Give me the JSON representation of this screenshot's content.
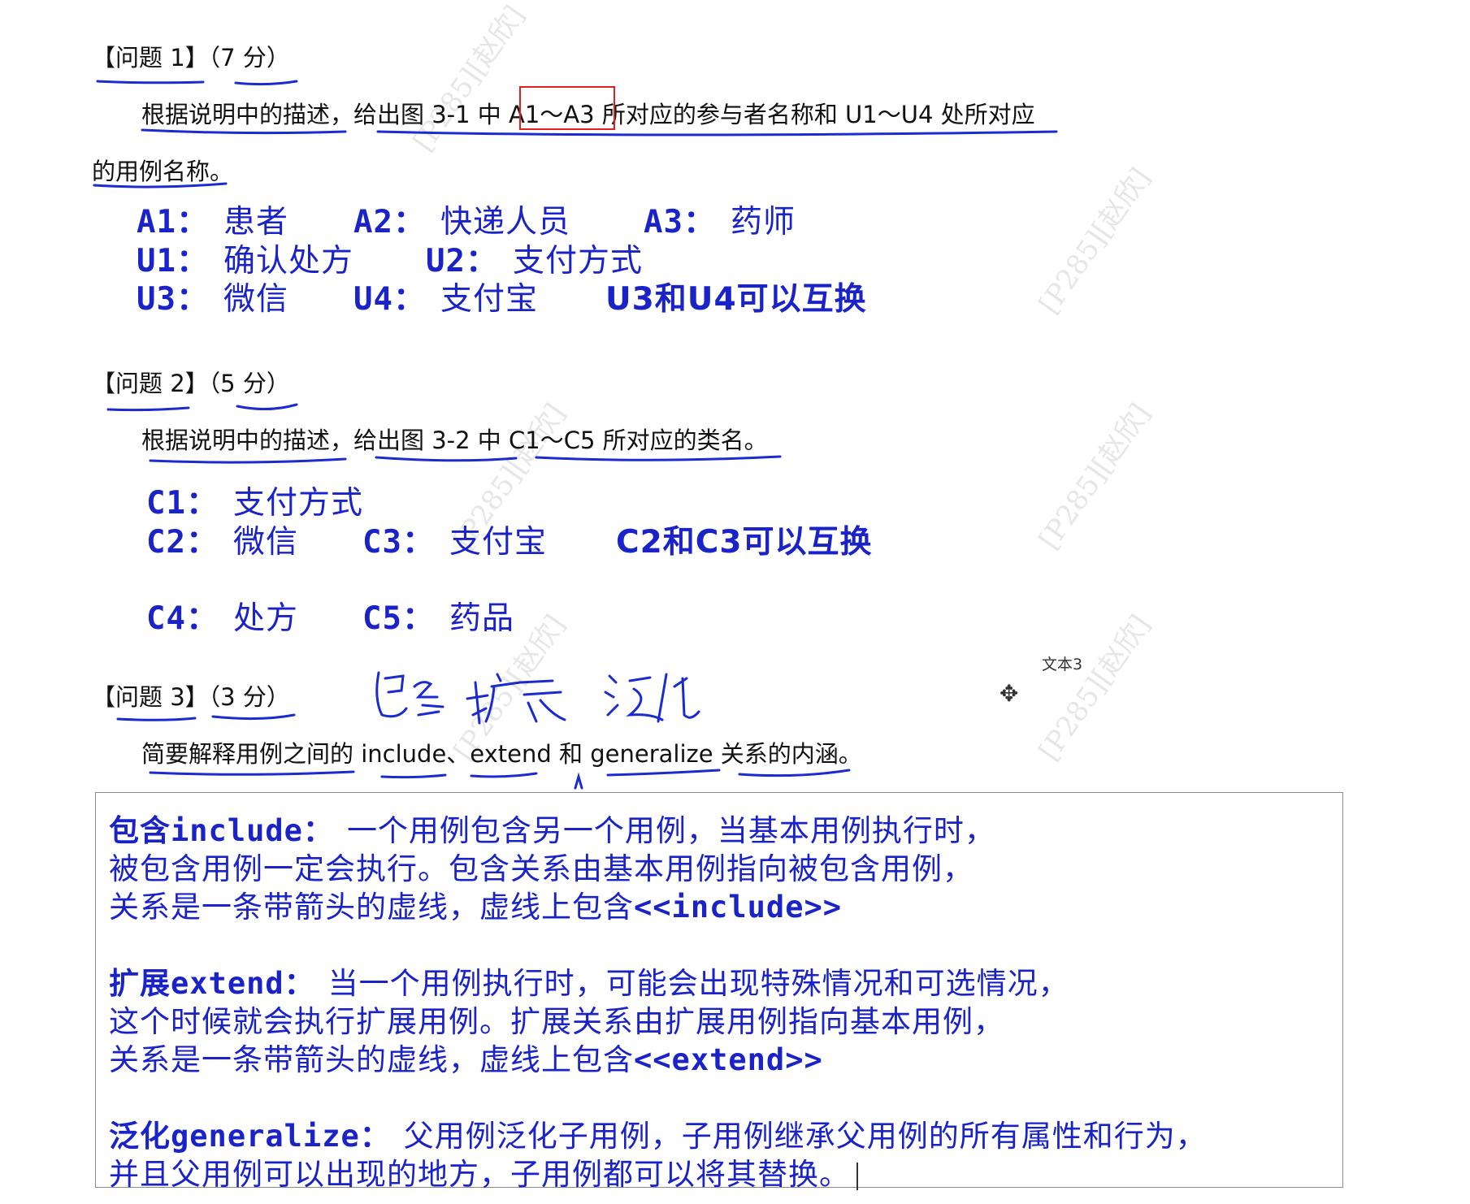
{
  "q1": {
    "heading": "【问题 1】（7 分）",
    "text_line1": "根据说明中的描述，给出图 3-1 中 A1～A3 所对应的参与者名称和 U1～U4 处所对应",
    "text_line2": "的用例名称。",
    "answers": {
      "a1_label": "A1：",
      "a1_value": "患者",
      "a2_label": "A2：",
      "a2_value": "快递人员",
      "a3_label": "A3：",
      "a3_value": "药师",
      "u1_label": "U1：",
      "u1_value": "确认处方",
      "u2_label": "U2：",
      "u2_value": "支付方式",
      "u3_label": "U3：",
      "u3_value": "微信",
      "u4_label": "U4：",
      "u4_value": "支付宝",
      "note": "U3和U4可以互换"
    }
  },
  "q2": {
    "heading": "【问题 2】（5 分）",
    "text": "根据说明中的描述，给出图 3-2 中 C1～C5 所对应的类名。",
    "answers": {
      "c1_label": "C1：",
      "c1_value": "支付方式",
      "c2_label": "C2：",
      "c2_value": "微信",
      "c3_label": "C3：",
      "c3_value": "支付宝",
      "note": "C2和C3可以互换",
      "c4_label": "C4：",
      "c4_value": "处方",
      "c5_label": "C5：",
      "c5_value": "药品"
    }
  },
  "q3": {
    "heading": "【问题 3】（3 分）",
    "text": "简要解释用例之间的 include、extend 和 generalize 关系的内涵。",
    "handwriting": "包含 扩展 泛化",
    "textbox_label": "文本3"
  },
  "answer_box": {
    "include_kw": "包含include：",
    "include_l1": "一个用例包含另一个用例，当基本用例执行时，",
    "include_l2": "被包含用例一定会执行。包含关系由基本用例指向被包含用例，",
    "include_l3a": "关系是一条带箭头的虚线，虚线上包含",
    "include_l3b": "<<include>>",
    "extend_kw": "扩展extend：",
    "extend_l1": "当一个用例执行时，可能会出现特殊情况和可选情况，",
    "extend_l2": "这个时候就会执行扩展用例。扩展关系由扩展用例指向基本用例，",
    "extend_l3a": "关系是一条带箭头的虚线，虚线上包含",
    "extend_l3b": "<<extend>>",
    "gen_kw": "泛化generalize：",
    "gen_l1": "父用例泛化子用例，子用例继承父用例的所有属性和行为，",
    "gen_l2": "并且父用例可以出现的地方，子用例都可以将其替换。"
  },
  "watermark_text": "[P285][赵欣]",
  "colors": {
    "answer_blue": "#1a23c8",
    "highlight_red": "#e02020",
    "ink_blue": "#1b2bd0"
  }
}
